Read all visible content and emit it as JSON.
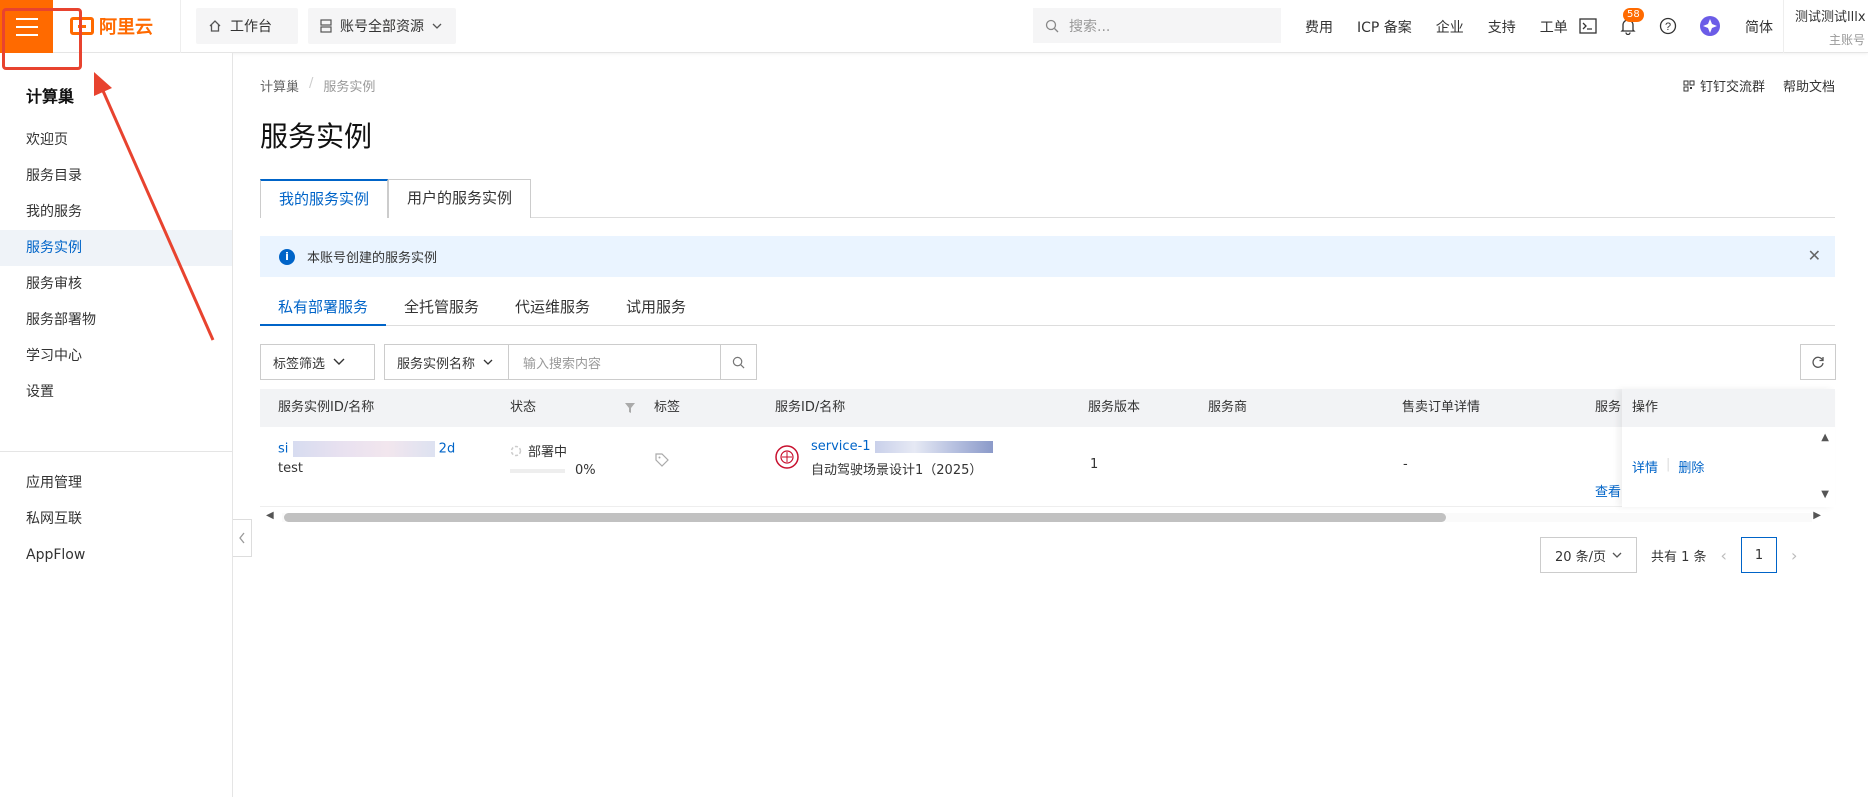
{
  "header": {
    "logo_text": "阿里云",
    "workbench_label": "工作台",
    "resource_label": "账号全部资源",
    "search_placeholder": "搜索...",
    "links": [
      "费用",
      "ICP 备案",
      "企业",
      "支持",
      "工单"
    ],
    "notification_count": "58",
    "lang_label": "简体",
    "account_name": "测试测试lllx",
    "account_role": "主账号"
  },
  "sidebar": {
    "title": "计算巢",
    "items": [
      "欢迎页",
      "服务目录",
      "我的服务",
      "服务实例",
      "服务审核",
      "服务部署物",
      "学习中心",
      "设置"
    ],
    "active_index": 3,
    "items2": [
      "应用管理",
      "私网互联",
      "AppFlow"
    ]
  },
  "breadcrumb": {
    "root": "计算巢",
    "current": "服务实例"
  },
  "help": {
    "dingtalk": "钉钉交流群",
    "docs": "帮助文档"
  },
  "page_title": "服务实例",
  "tabs": [
    "我的服务实例",
    "用户的服务实例"
  ],
  "notice": "本账号创建的服务实例",
  "subtabs": [
    "私有部署服务",
    "全托管服务",
    "代运维服务",
    "试用服务"
  ],
  "filter": {
    "tag_filter": "标签筛选",
    "field_select": "服务实例名称",
    "search_placeholder": "输入搜索内容"
  },
  "table": {
    "headers": [
      "服务实例ID/名称",
      "状态",
      "标签",
      "服务ID/名称",
      "服务版本",
      "服务商",
      "售卖订单详情",
      "服务",
      "操作"
    ],
    "row": {
      "id_prefix": "si",
      "id_suffix": "2d",
      "name": "test",
      "status": "部署中",
      "progress_text": "0%",
      "progress": 0,
      "service_id": "service-1",
      "service_name": "自动驾驶场景设计1（2025）",
      "version": "1",
      "order_detail": "-",
      "view_link": "查看",
      "actions": [
        "详情",
        "删除"
      ]
    }
  },
  "pagination": {
    "page_size": "20 条/页",
    "total": "共有 1 条",
    "current_page": "1"
  },
  "colors": {
    "brand": "#ff6a00",
    "link": "#0064c8",
    "annotation": "#e8432f"
  }
}
